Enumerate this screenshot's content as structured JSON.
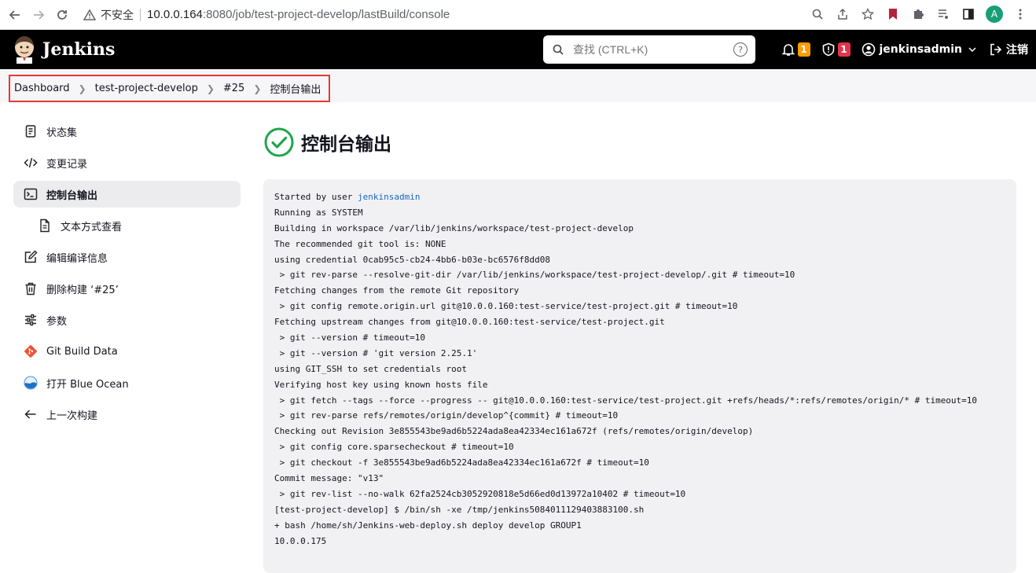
{
  "browser": {
    "security_label": "不安全",
    "url_host": "10.0.0.164",
    "url_path": ":8080/job/test-project-develop/lastBuild/console",
    "avatar_letter": "A"
  },
  "header": {
    "title": "Jenkins",
    "search_placeholder": "查找 (CTRL+K)",
    "help": "?",
    "notifications_count": "1",
    "security_count": "1",
    "user": "jenkinsadmin",
    "logout": "注销"
  },
  "breadcrumb": [
    "Dashboard",
    "test-project-develop",
    "#25",
    "控制台输出"
  ],
  "sidebar": {
    "items": [
      {
        "label": "状态集",
        "icon": "document-icon"
      },
      {
        "label": "变更记录",
        "icon": "code-icon"
      },
      {
        "label": "控制台输出",
        "icon": "terminal-icon"
      },
      {
        "label": "文本方式查看",
        "icon": "file-text-icon"
      },
      {
        "label": "编辑编译信息",
        "icon": "edit-icon"
      },
      {
        "label": "删除构建 ‘#25’",
        "icon": "trash-icon"
      },
      {
        "label": "参数",
        "icon": "sliders-icon"
      },
      {
        "label": "Git Build Data",
        "icon": "git-icon"
      },
      {
        "label": "打开 Blue Ocean",
        "icon": "blue-ocean-icon"
      },
      {
        "label": "上一次构建",
        "icon": "arrow-left-icon"
      }
    ]
  },
  "main": {
    "title": "控制台输出",
    "console": {
      "first_line_prefix": "Started by user ",
      "first_line_user": "jenkinsadmin",
      "lines": [
        "Running as SYSTEM",
        "Building in workspace /var/lib/jenkins/workspace/test-project-develop",
        "The recommended git tool is: NONE",
        "using credential 0cab95c5-cb24-4bb6-b03e-bc6576f8dd08",
        " > git rev-parse --resolve-git-dir /var/lib/jenkins/workspace/test-project-develop/.git # timeout=10",
        "Fetching changes from the remote Git repository",
        " > git config remote.origin.url git@10.0.0.160:test-service/test-project.git # timeout=10",
        "Fetching upstream changes from git@10.0.0.160:test-service/test-project.git",
        " > git --version # timeout=10",
        " > git --version # 'git version 2.25.1'",
        "using GIT_SSH to set credentials root",
        "Verifying host key using known hosts file",
        " > git fetch --tags --force --progress -- git@10.0.0.160:test-service/test-project.git +refs/heads/*:refs/remotes/origin/* # timeout=10",
        " > git rev-parse refs/remotes/origin/develop^{commit} # timeout=10",
        "Checking out Revision 3e855543be9ad6b5224ada8ea42334ec161a672f (refs/remotes/origin/develop)",
        " > git config core.sparsecheckout # timeout=10",
        " > git checkout -f 3e855543be9ad6b5224ada8ea42334ec161a672f # timeout=10",
        "Commit message: \"v13\"",
        " > git rev-list --no-walk 62fa2524cb3052920818e5d66ed0d13972a10402 # timeout=10",
        "[test-project-develop] $ /bin/sh -xe /tmp/jenkins5084011129403883100.sh",
        "+ bash /home/sh/Jenkins-web-deploy.sh deploy develop GROUP1",
        "10.0.0.175"
      ]
    }
  },
  "colors": {
    "header_bg": "#000000",
    "success_green": "#1ea64b",
    "link_blue": "#1667c7",
    "badge_orange": "#fe9d00",
    "badge_red": "#e6334c",
    "highlight_red": "#e53935"
  }
}
